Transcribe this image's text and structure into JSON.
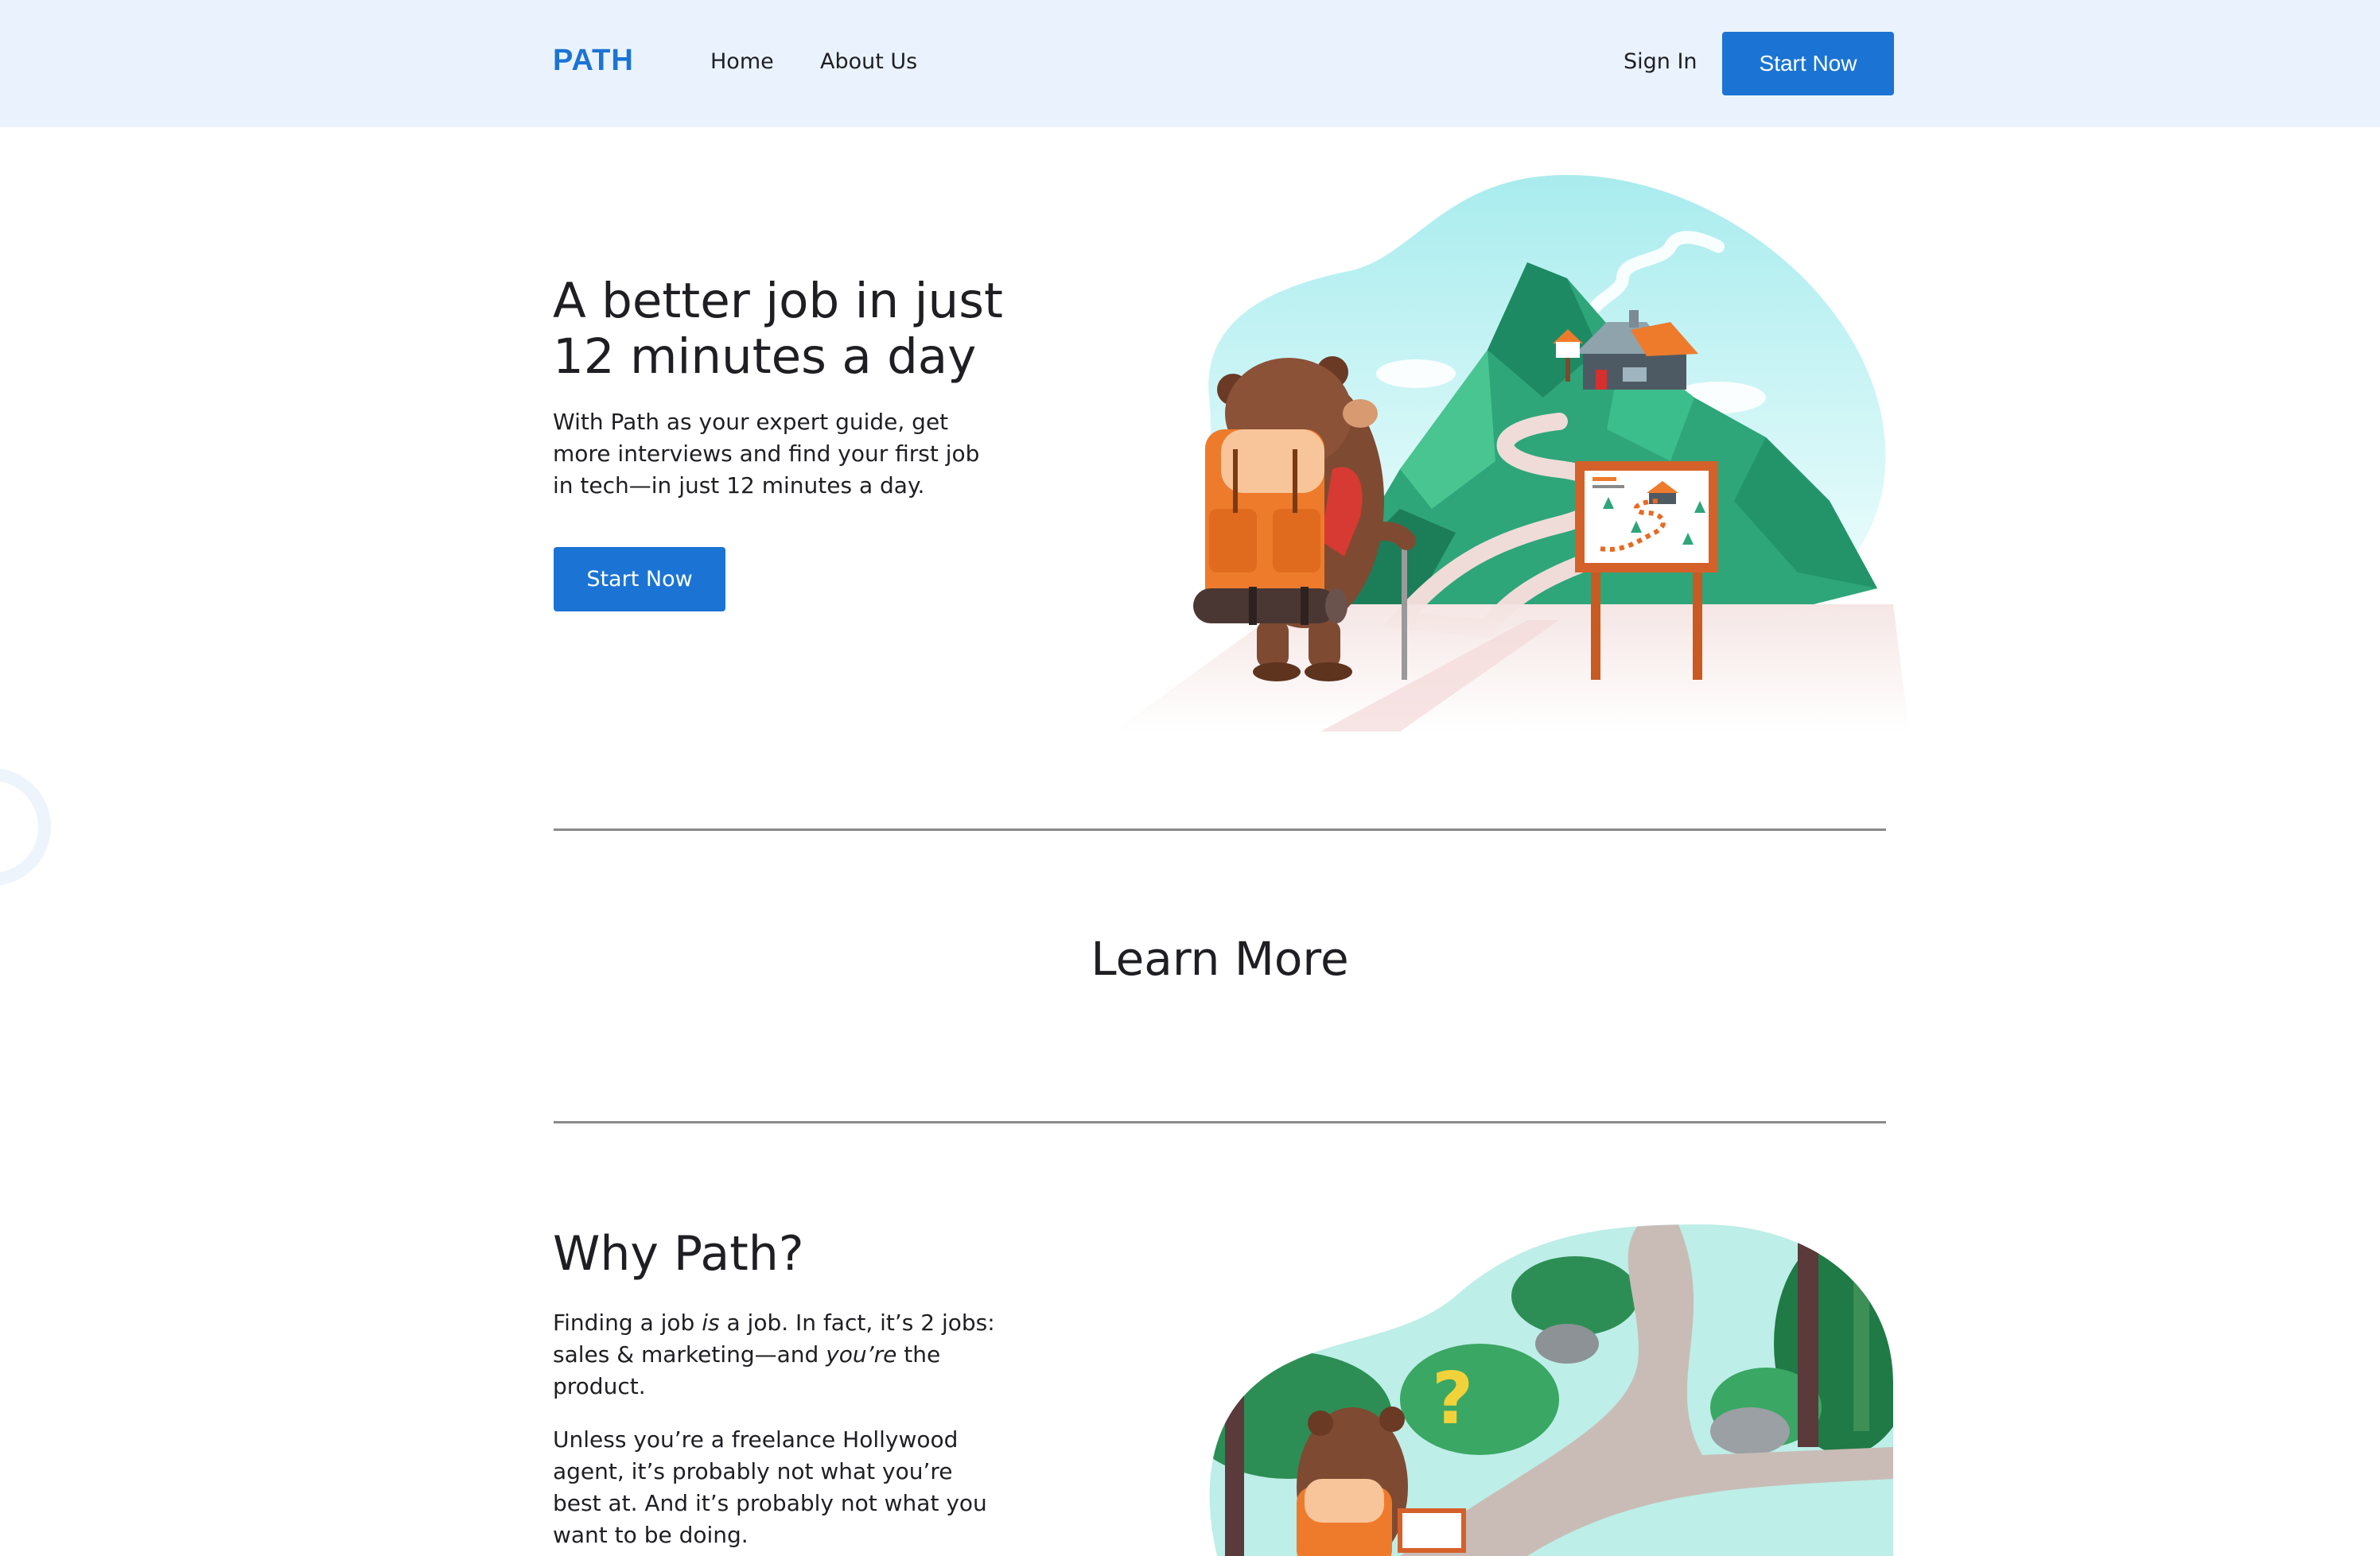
{
  "header": {
    "logo": "PATH",
    "nav": [
      {
        "label": "Home"
      },
      {
        "label": "About Us"
      }
    ],
    "sign_in": "Sign In",
    "cta": "Start Now"
  },
  "hero": {
    "title_line1": "A better job in just",
    "title_line2": "12 minutes a day",
    "description": "With Path as your expert guide, get more interviews and find your first job in tech—in just 12 minutes a day.",
    "cta": "Start Now",
    "illustration_icon": "bear-hiker-mountain-illustration"
  },
  "learn_more": {
    "title": "Learn More"
  },
  "why": {
    "title": "Why Path?",
    "p1_a": "Finding a job ",
    "p1_em1": "is",
    "p1_b": " a job. In fact, it’s 2 jobs: sales & marketing—and ",
    "p1_em2": "you’re",
    "p1_c": " the product.",
    "p2": "Unless you’re a freelance Hollywood agent, it’s probably not what you’re best at. And it’s probably not what you want to be doing.",
    "illustration_icon": "bear-forest-path-illustration"
  },
  "colors": {
    "accent": "#1b74d4",
    "header_bg": "#eaf3fd",
    "text": "#1f1f23",
    "divider": "#8a8a8a"
  }
}
